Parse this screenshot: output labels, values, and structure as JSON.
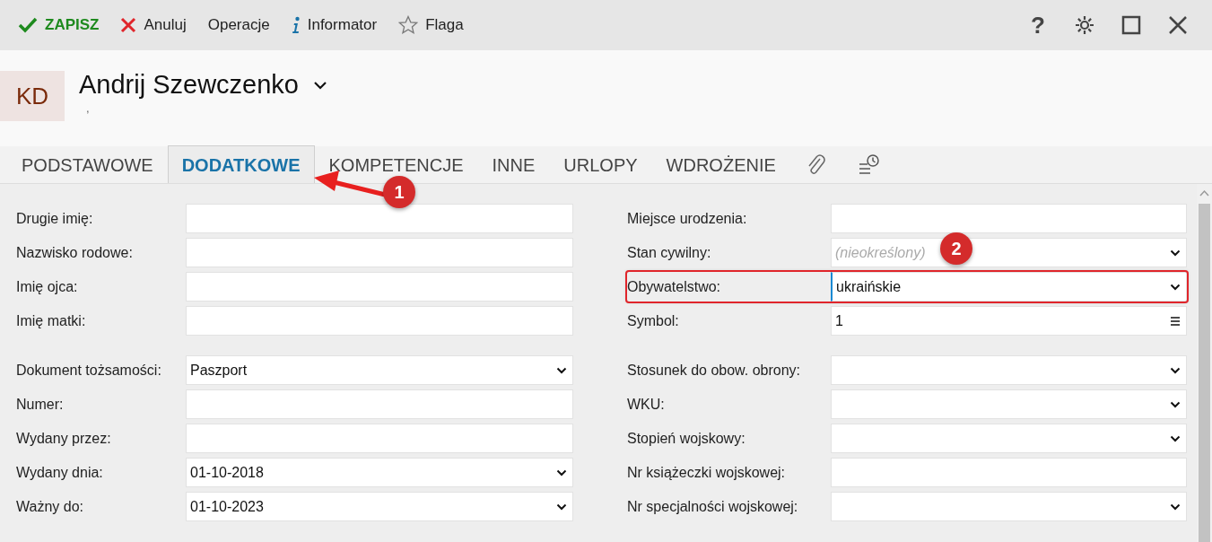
{
  "toolbar": [
    {
      "kind": "save",
      "label": "ZAPISZ"
    },
    {
      "kind": "cancel",
      "label": "Anuluj"
    },
    {
      "kind": "plain",
      "label": "Operacje"
    },
    {
      "kind": "info",
      "label": "Informator"
    },
    {
      "kind": "flag",
      "label": "Flaga"
    }
  ],
  "window_controls": [
    {
      "kind": "help",
      "label": "?"
    },
    {
      "kind": "settings"
    },
    {
      "kind": "maximize"
    },
    {
      "kind": "close"
    }
  ],
  "header": {
    "avatar": "KD",
    "name": "Andrij Szewczenko",
    "subtitle": ","
  },
  "tabs": [
    {
      "kind": "text",
      "label": "PODSTAWOWE",
      "selected": false
    },
    {
      "kind": "text",
      "label": "DODATKOWE",
      "selected": true
    },
    {
      "kind": "text",
      "label": "KOMPETENCJE",
      "selected": false
    },
    {
      "kind": "text",
      "label": "INNE",
      "selected": false
    },
    {
      "kind": "text",
      "label": "URLOPY",
      "selected": false
    },
    {
      "kind": "text",
      "label": "WDROŻENIE",
      "selected": false
    },
    {
      "kind": "attachment",
      "selected": false
    },
    {
      "kind": "history",
      "selected": false
    }
  ],
  "form": {
    "columns": [
      [
        [
          {
            "label": "Drugie imię:",
            "kind": "text"
          },
          {
            "label": "Nazwisko rodowe:",
            "kind": "text"
          },
          {
            "label": "Imię ojca:",
            "kind": "text"
          },
          {
            "label": "Imię matki:",
            "kind": "text"
          }
        ],
        [
          {
            "label": "Dokument tożsamości:",
            "kind": "select",
            "value": "Paszport"
          },
          {
            "label": "Numer:",
            "kind": "text"
          },
          {
            "label": "Wydany przez:",
            "kind": "text"
          },
          {
            "label": "Wydany dnia:",
            "kind": "select",
            "value": "01-10-2018"
          },
          {
            "label": "Ważny do:",
            "kind": "select",
            "value": "01-10-2023"
          }
        ]
      ],
      [
        [
          {
            "label": "Miejsce urodzenia:",
            "kind": "text"
          },
          {
            "label": "Stan cywilny:",
            "kind": "select",
            "placeholder": "(nieokreślony)"
          },
          {
            "label": "Obywatelstwo:",
            "kind": "select",
            "value": "ukraińskie",
            "highlighted": true,
            "focused": true
          },
          {
            "label": "Symbol:",
            "kind": "lookup",
            "value": "1"
          }
        ],
        [
          {
            "label": "Stosunek do obow. obrony:",
            "kind": "select"
          },
          {
            "label": "WKU:",
            "kind": "select"
          },
          {
            "label": "Stopień wojskowy:",
            "kind": "select"
          },
          {
            "label": "Nr książeczki wojskowej:",
            "kind": "text"
          },
          {
            "label": "Nr specjalności wojskowej:",
            "kind": "select"
          }
        ]
      ]
    ]
  },
  "annotations": {
    "badges": [
      {
        "label": "1"
      },
      {
        "label": "2"
      }
    ]
  }
}
